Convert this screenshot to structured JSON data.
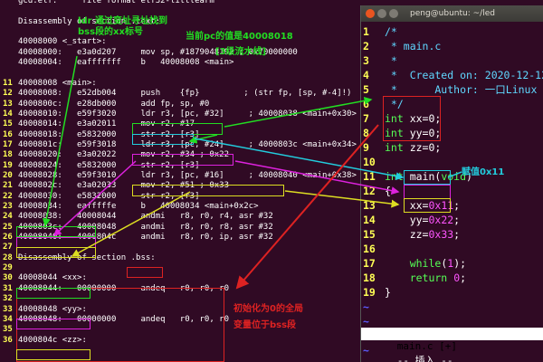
{
  "left_pane": {
    "lines": [
      {
        "n": "",
        "text": "gcd.elf:     file format elf32-littlearm"
      },
      {
        "n": "",
        "text": ""
      },
      {
        "n": "",
        "text": "Disassembly of section .text:"
      },
      {
        "n": "",
        "text": ""
      },
      {
        "n": "",
        "text": "40008000 <_start>:"
      },
      {
        "n": "",
        "text": "40008000:   e3a0d207     mov sp, #1879048192 ; 0x70000000"
      },
      {
        "n": "",
        "text": "40008004:   eafffffff    b   40008008 <main>"
      },
      {
        "n": "",
        "text": ""
      },
      {
        "n": "11",
        "text": "40008008 <main>:"
      },
      {
        "n": "12",
        "text": "40008008:   e52db004     push    {fp}         ; (str fp, [sp, #-4]!)"
      },
      {
        "n": "13",
        "text": "4000800c:   e28db000     add fp, sp, #0"
      },
      {
        "n": "14",
        "text": "40008010:   e59f3020     ldr r3, [pc, #32]     ; 40008038 <main+0x30>"
      },
      {
        "n": "15",
        "text": "40008014:   e3a02011     mov r2, #17"
      },
      {
        "n": "16",
        "text": "40008018:   e5832000     str r2, [r3]"
      },
      {
        "n": "17",
        "text": "4000801c:   e59f3018     ldr r3, [pc, #24]     ; 4000803c <main+0x34>"
      },
      {
        "n": "18",
        "text": "40008020:   e3a02022     mov r2, #34 ; 0x22"
      },
      {
        "n": "19",
        "text": "40008024:   e5832000     str r2, [r3]"
      },
      {
        "n": "20",
        "text": "40008028:   e59f3010     ldr r3, [pc, #16]     ; 40008040 <main+0x38>"
      },
      {
        "n": "21",
        "text": "4000802c:   e3a02033     mov r2, #51 ; 0x33"
      },
      {
        "n": "22",
        "text": "40008030:   e5832000     str r2, [r3]"
      },
      {
        "n": "23",
        "text": "40008034:   eafffffe     b   40008034 <main+0x2c>"
      },
      {
        "n": "24",
        "text": "40008038:   40008044     andmi   r8, r0, r4, asr #32"
      },
      {
        "n": "25",
        "text": "4000803c:   40008048     andmi   r8, r0, r8, asr #32"
      },
      {
        "n": "26",
        "text": "40008040:   4000804c     andmi   r8, r0, ip, asr #32"
      },
      {
        "n": "27",
        "text": ""
      },
      {
        "n": "28",
        "text": "Disassembly of section .bss:"
      },
      {
        "n": "29",
        "text": ""
      },
      {
        "n": "30",
        "text": "40008044 <xx>:"
      },
      {
        "n": "31",
        "text": "40008044:   00000000     andeq   r0, r0, r0"
      },
      {
        "n": "32",
        "text": ""
      },
      {
        "n": "33",
        "text": "40008048 <yy>:"
      },
      {
        "n": "34",
        "text": "40008048:   00000000     andeq   r0, r0, r0"
      },
      {
        "n": "35",
        "text": ""
      },
      {
        "n": "36",
        "text": "4000804c <zz>:"
      }
    ]
  },
  "right_pane": {
    "title": "peng@ubuntu: ~/led",
    "lines": [
      {
        "n": "1",
        "parts": [
          {
            "t": "/*",
            "c": "cm"
          }
        ]
      },
      {
        "n": "2",
        "parts": [
          {
            "t": " * main.c",
            "c": "cm"
          }
        ]
      },
      {
        "n": "3",
        "parts": [
          {
            "t": " *",
            "c": "cm"
          }
        ]
      },
      {
        "n": "4",
        "parts": [
          {
            "t": " *  Created on: 2020-12-12",
            "c": "cm"
          }
        ]
      },
      {
        "n": "5",
        "parts": [
          {
            "t": " *      Author: 一口Linux",
            "c": "cm"
          }
        ]
      },
      {
        "n": "6",
        "parts": [
          {
            "t": " */",
            "c": "cm"
          }
        ]
      },
      {
        "n": "7",
        "parts": [
          {
            "t": "int",
            "c": "kw"
          },
          {
            "t": " xx=0;",
            "c": "tx"
          }
        ]
      },
      {
        "n": "8",
        "parts": [
          {
            "t": "int",
            "c": "kw"
          },
          {
            "t": " yy=0;",
            "c": "tx"
          }
        ]
      },
      {
        "n": "9",
        "parts": [
          {
            "t": "int",
            "c": "kw"
          },
          {
            "t": " zz=0;",
            "c": "tx"
          }
        ]
      },
      {
        "n": "10",
        "parts": []
      },
      {
        "n": "11",
        "parts": [
          {
            "t": "int",
            "c": "kw"
          },
          {
            "t": " main(",
            "c": "tx"
          },
          {
            "t": "void",
            "c": "kw"
          },
          {
            "t": ")",
            "c": "tx"
          }
        ]
      },
      {
        "n": "12",
        "parts": [
          {
            "t": "{",
            "c": "tx"
          }
        ]
      },
      {
        "n": "13",
        "parts": [
          {
            "t": "    xx=",
            "c": "tx"
          },
          {
            "t": "0x11",
            "c": "num"
          },
          {
            "t": ";",
            "c": "tx"
          }
        ]
      },
      {
        "n": "14",
        "parts": [
          {
            "t": "    yy=",
            "c": "tx"
          },
          {
            "t": "0x22",
            "c": "num"
          },
          {
            "t": ";",
            "c": "tx"
          }
        ]
      },
      {
        "n": "15",
        "parts": [
          {
            "t": "    zz=",
            "c": "tx"
          },
          {
            "t": "0x33",
            "c": "num"
          },
          {
            "t": ";",
            "c": "tx"
          }
        ]
      },
      {
        "n": "16",
        "parts": []
      },
      {
        "n": "17",
        "parts": [
          {
            "t": "    while",
            "c": "kw"
          },
          {
            "t": "(",
            "c": "tx"
          },
          {
            "t": "1",
            "c": "num"
          },
          {
            "t": ");",
            "c": "tx"
          }
        ]
      },
      {
        "n": "18",
        "parts": [
          {
            "t": "    return",
            "c": "kw"
          },
          {
            "t": " ",
            "c": "tx"
          },
          {
            "t": "0",
            "c": "num"
          },
          {
            "t": ";",
            "c": "tx"
          }
        ]
      },
      {
        "n": "19",
        "parts": [
          {
            "t": "}",
            "c": "tx"
          }
        ]
      }
    ],
    "tilde_rows": 4,
    "status_file": "main.c [+]",
    "mode": "-- 插入 --"
  },
  "annotations": {
    "ldr_find": "ldr 通过变址寻址找到\nbss段的xx标号",
    "pc_value": "当前pc的值是40008018",
    "pipeline": "[3级流水线]",
    "assign": "赋值0x11",
    "init_note": "初始化为0的全局\n变量位于bss段"
  },
  "colors": {
    "bg": "#300a24",
    "green": "#22dd22",
    "cyan": "#22ccdd",
    "magenta": "#dd22dd",
    "yellow": "#dddd22",
    "red": "#dd2222"
  }
}
